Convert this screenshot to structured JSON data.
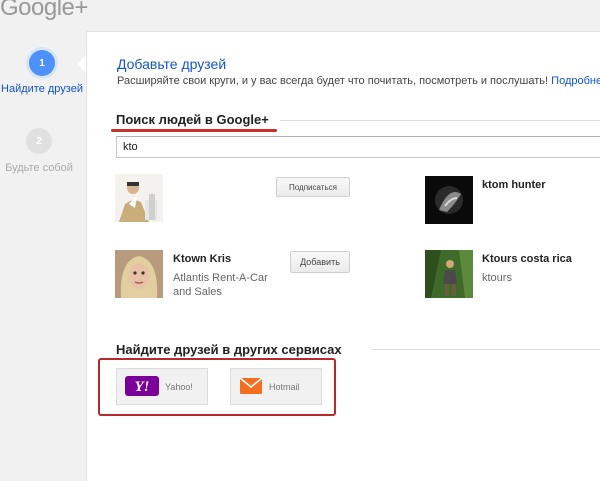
{
  "logo": "Google+",
  "steps": [
    {
      "number": "1",
      "label": "Найдите друзей"
    },
    {
      "number": "2",
      "label": "Будьте собой"
    }
  ],
  "header": {
    "title": "Добавьте друзей",
    "subtitle": "Расширяйте свои круги, и у вас всегда будет что почитать, посмотреть и послушать!",
    "more_link": "Подробнее"
  },
  "search_section": {
    "heading": "Поиск людей в Google+",
    "query": "kto"
  },
  "people": [
    {
      "name": "",
      "desc": "",
      "button": "Подписаться"
    },
    {
      "name": "ktom hunter",
      "desc": ""
    },
    {
      "name": "Ktown Kris",
      "desc": "Atlantis Rent-A-Car and Sales",
      "button": "Добавить"
    },
    {
      "name": "Ktours costa rica",
      "desc": "ktours"
    }
  ],
  "services_section": {
    "heading": "Найдите друзей в других сервисах",
    "services": [
      {
        "label": "Yahoo!",
        "icon": "yahoo-icon",
        "color": "#7b0099"
      },
      {
        "label": "Hotmail",
        "icon": "hotmail-envelope-icon",
        "color": "#f37021"
      }
    ]
  },
  "colors": {
    "accent": "#1155cc",
    "highlight": "#c9302c"
  }
}
